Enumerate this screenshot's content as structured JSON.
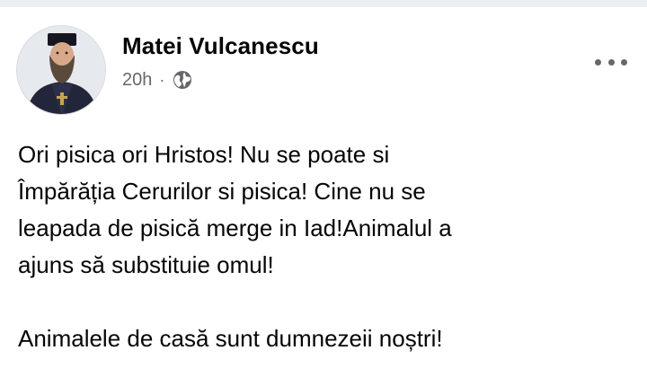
{
  "post": {
    "author": {
      "name": "Matei Vulcanescu",
      "avatar_icon": "profile-photo-priest"
    },
    "timestamp": "20h",
    "meta_separator": "·",
    "privacy_icon": "globe-icon",
    "more_icon": "more-options-icon",
    "lines": [
      "Ori pisica ori Hristos! Nu se poate si",
      "Împărăția Cerurilor si pisica! Cine nu se",
      "leapada de pisică merge in Iad!Animalul a",
      "ajuns să substituie omul!"
    ],
    "final_line": "Animalele de casă sunt dumnezeii noștri!"
  },
  "colors": {
    "text_primary": "#050505",
    "text_secondary": "#65676b",
    "divider": "#eceff2"
  }
}
